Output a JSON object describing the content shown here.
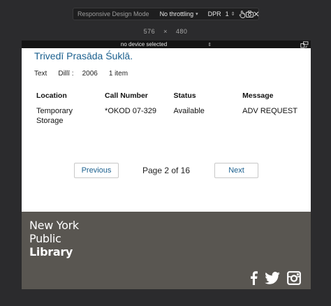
{
  "toolbar": {
    "title": "Responsive Design Mode",
    "throttling": "No throttling",
    "dpr_label": "DPR",
    "dpr_value": "1",
    "icons": [
      "touch-icon",
      "screenshot-icon",
      "close-icon"
    ]
  },
  "dimensions": {
    "width": "576",
    "separator": "×",
    "height": "480"
  },
  "device_bar": {
    "device": "no device selected",
    "icon": "rotate-icon"
  },
  "record": {
    "title": "Trivedī Prasāda Śuklā.",
    "type": "Text",
    "place": "Dillī :",
    "year": "2006",
    "items": "1 item"
  },
  "holdings": {
    "headers": [
      "Location",
      "Call Number",
      "Status",
      "Message"
    ],
    "rows": [
      {
        "location_line1": "Temporary",
        "location_line2": "Storage",
        "call_number": "*OKOD 07-329",
        "status": "Available",
        "message": "ADV REQUEST"
      }
    ]
  },
  "pagination": {
    "previous": "Previous",
    "page_info": "Page 2 of 16",
    "next": "Next"
  },
  "footer": {
    "logo_line1": "New York",
    "logo_line2": "Public",
    "logo_line3": "Library",
    "social": [
      "facebook-icon",
      "twitter-icon",
      "instagram-icon"
    ],
    "color": "#595651"
  },
  "colors": {
    "link": "#1a5f8e",
    "background": "#2b2b2d"
  }
}
